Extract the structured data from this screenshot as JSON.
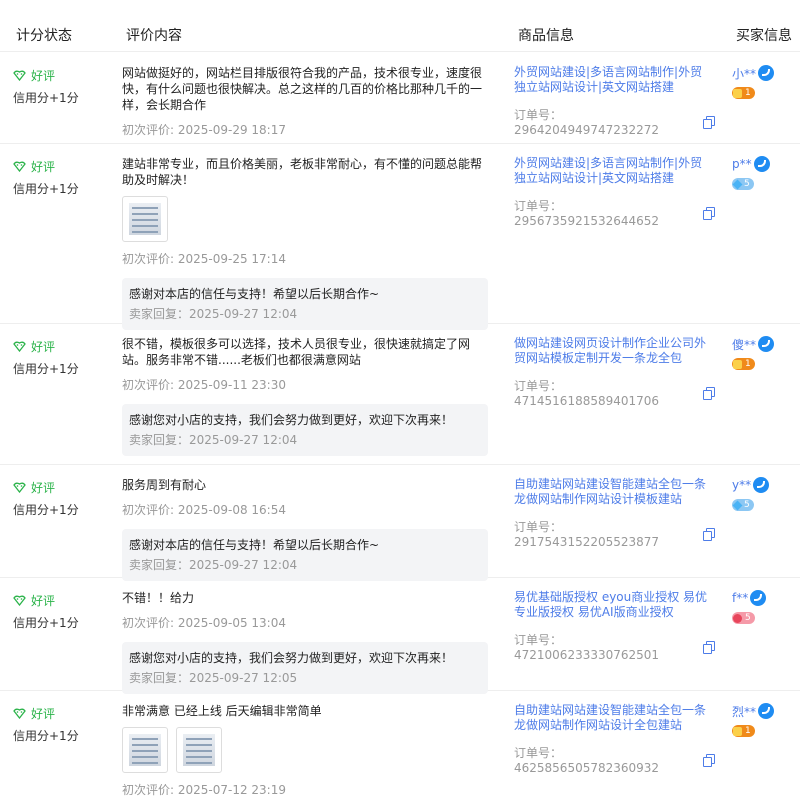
{
  "header": {
    "col_score": "计分状态",
    "col_content": "评价内容",
    "col_goods": "商品信息",
    "col_buyer": "买家信息"
  },
  "colors": {
    "accent_link": "#4d7ce8",
    "good": "#2bb34a",
    "muted": "#999999"
  },
  "rows": [
    {
      "rating": "好评",
      "credit": "信用分+1分",
      "text": "网站做挺好的，网站栏目排版很符合我的产品，技术很专业，速度很快，有什么问题也很快解决。总之这样的几百的价格比那种几千的一样，会长期合作",
      "date": "初次评价: 2025-09-29 18:17",
      "goods": "外贸网站建设|多语言网站制作|外贸独立站网站设计|英文网站搭建",
      "order": "订单号：2964204949747232272",
      "buyer": "小**",
      "badge": "1"
    },
    {
      "rating": "好评",
      "credit": "信用分+1分",
      "text": "建站非常专业，而且价格美丽，老板非常耐心，有不懂的问题总能帮助及时解决！",
      "date": "初次评价: 2025-09-25 17:14",
      "reply": "感谢对本店的信任与支持！希望以后长期合作~",
      "reply_date": "卖家回复：2025-09-27 12:04",
      "goods": "外贸网站建设|多语言网站制作|外贸独立站网站设计|英文网站搭建",
      "order": "订单号：2956735921532644652",
      "buyer": "p**",
      "badge": "5"
    },
    {
      "rating": "好评",
      "credit": "信用分+1分",
      "text": "很不错，模板很多可以选择，技术人员很专业，很快速就搞定了网站。服务非常不错......老板们也都很满意网站",
      "date": "初次评价: 2025-09-11 23:30",
      "reply": "感谢您对小店的支持，我们会努力做到更好，欢迎下次再来！",
      "reply_date": "卖家回复：2025-09-27 12:04",
      "goods": "做网站建设网页设计制作企业公司外贸网站模板定制开发一条龙全包",
      "order": "订单号：4714516188589401706",
      "buyer": "傻**",
      "badge": "1"
    },
    {
      "rating": "好评",
      "credit": "信用分+1分",
      "text": "服务周到有耐心",
      "date": "初次评价: 2025-09-08 16:54",
      "reply": "感谢对本店的信任与支持！希望以后长期合作~",
      "reply_date": "卖家回复：2025-09-27 12:04",
      "goods": "自助建站网站建设智能建站全包一条龙做网站制作网站设计模板建站",
      "order": "订单号：2917543152205523877",
      "buyer": "y**",
      "badge": "5"
    },
    {
      "rating": "好评",
      "credit": "信用分+1分",
      "text": "不错！！给力",
      "date": "初次评价: 2025-09-05 13:04",
      "reply": "感谢您对小店的支持，我们会努力做到更好，欢迎下次再来！",
      "reply_date": "卖家回复：2025-09-27 12:05",
      "goods": "易优基础版授权 eyou商业授权 易优专业版授权 易优AI版商业授权",
      "order": "订单号：4721006233330762501",
      "buyer": "f**",
      "badge": "5"
    },
    {
      "rating": "好评",
      "credit": "信用分+1分",
      "text": "非常满意 已经上线 后天编辑非常简单",
      "date": "初次评价: 2025-07-12 23:19",
      "goods": "自助建站网站建设智能建站全包一条龙做网站制作网站设计全包建站",
      "order": "订单号：4625856505782360932",
      "buyer": "烈**",
      "badge": "1"
    }
  ]
}
